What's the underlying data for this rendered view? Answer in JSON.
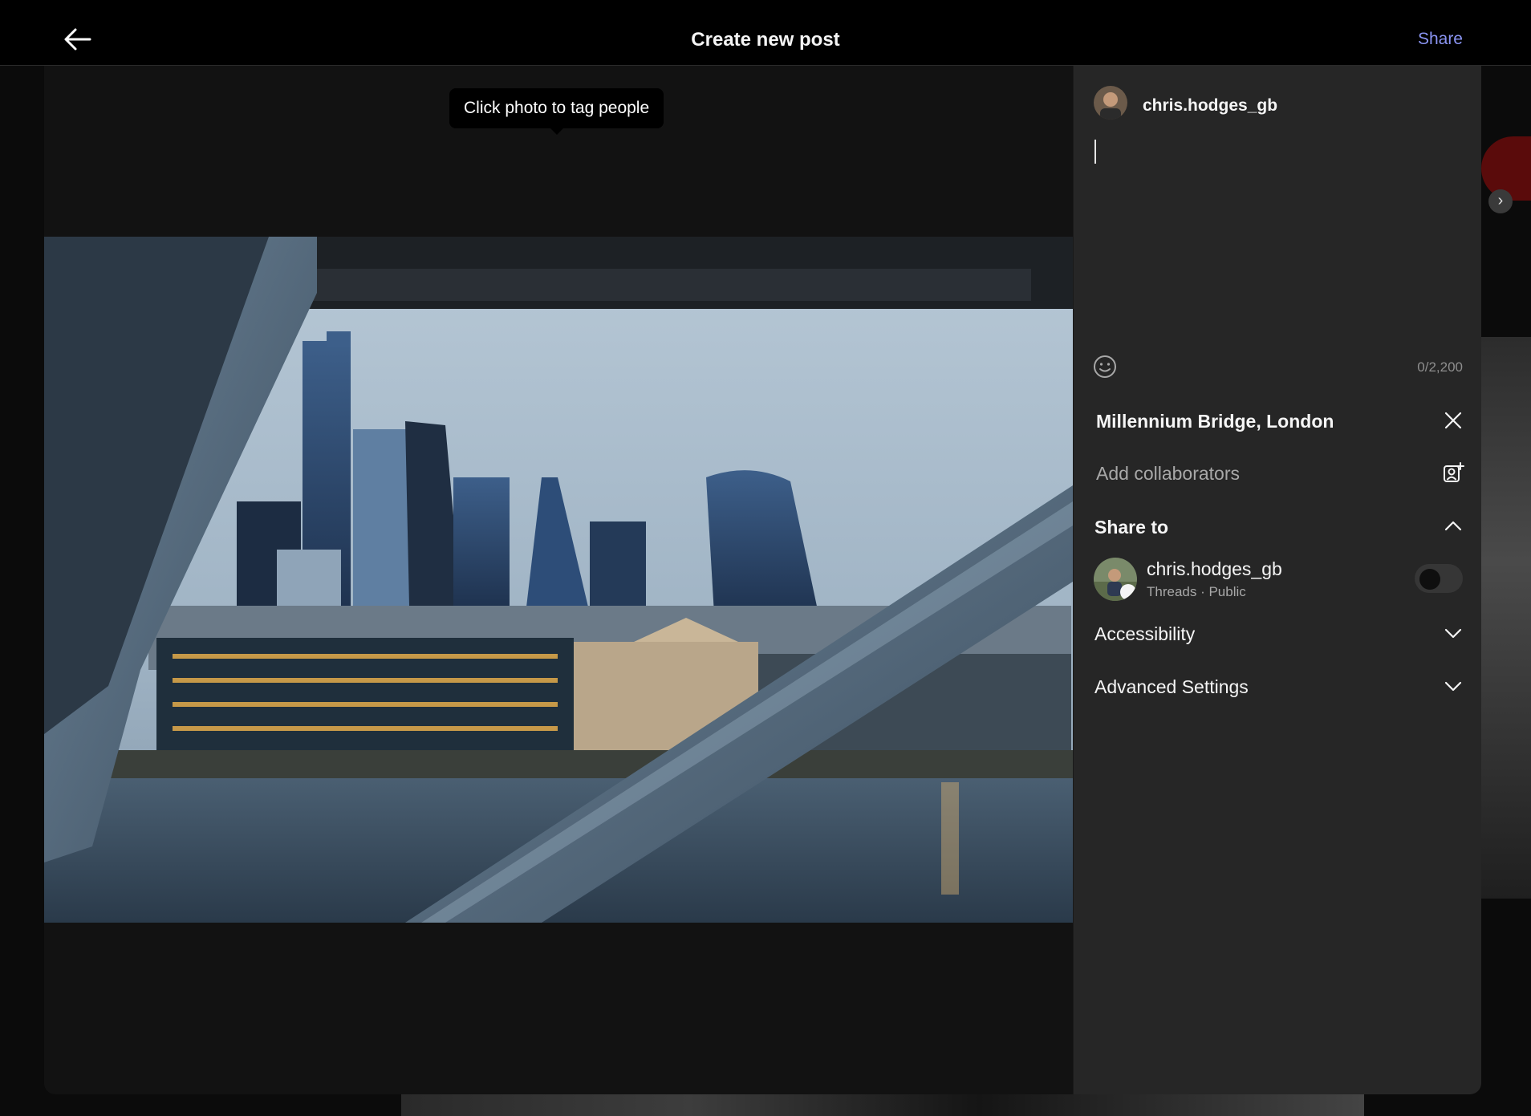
{
  "header": {
    "title": "Create new post",
    "share_label": "Share",
    "share_color": "#8a94f2"
  },
  "photo": {
    "tag_hint": "Click photo to tag people"
  },
  "composer": {
    "username": "chris.hodges_gb",
    "caption_value": "",
    "char_counter": "0/2,200",
    "emoji_icon": "smiley-icon"
  },
  "location": {
    "value": "Millennium Bridge, London",
    "clear_icon": "close-icon"
  },
  "collaborators": {
    "placeholder": "Add collaborators",
    "icon": "add-person-icon"
  },
  "share_to": {
    "title": "Share to",
    "expanded": true,
    "account": {
      "name": "chris.hodges_gb",
      "subtitle": "Threads · Public",
      "enabled": false
    }
  },
  "sections": {
    "accessibility": "Accessibility",
    "advanced": "Advanced Settings"
  }
}
